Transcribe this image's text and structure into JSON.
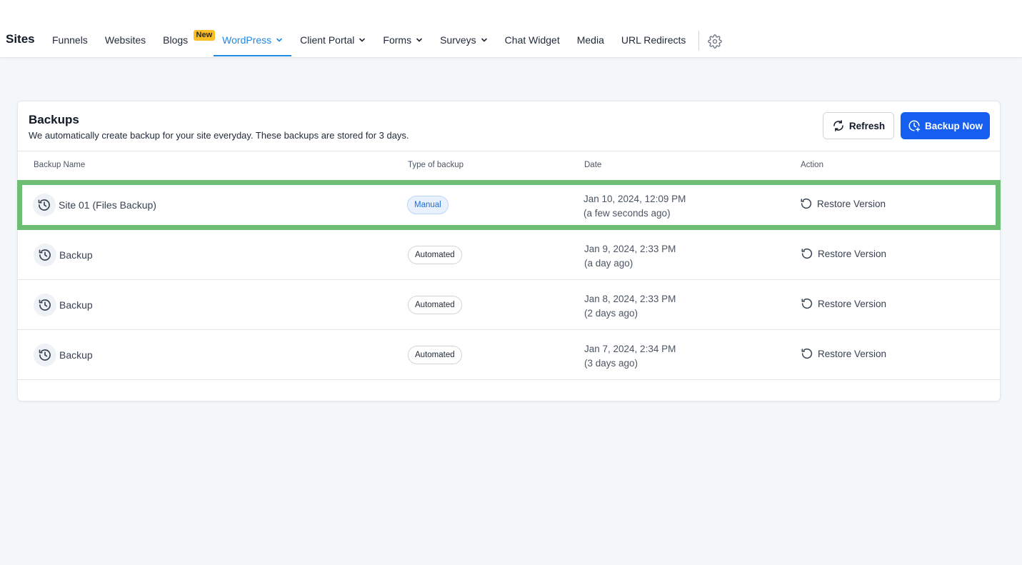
{
  "brand": "Sites",
  "nav": {
    "items": [
      {
        "label": "Funnels"
      },
      {
        "label": "Websites"
      },
      {
        "label": "Blogs",
        "badge": "New"
      },
      {
        "label": "WordPress",
        "active": true,
        "dropdown": true
      },
      {
        "label": "Client Portal",
        "dropdown": true
      },
      {
        "label": "Forms",
        "dropdown": true
      },
      {
        "label": "Surveys",
        "dropdown": true
      },
      {
        "label": "Chat Widget"
      },
      {
        "label": "Media"
      },
      {
        "label": "URL Redirects"
      }
    ],
    "settings_icon": "gear-icon"
  },
  "backups": {
    "title": "Backups",
    "subtitle": "We automatically create backup for your site everyday. These backups are stored for 3 days.",
    "refresh_label": "Refresh",
    "backup_now_label": "Backup Now",
    "columns": {
      "name": "Backup Name",
      "type": "Type of backup",
      "date": "Date",
      "action": "Action"
    },
    "rows": [
      {
        "name": "Site 01 (Files Backup)",
        "type": "Manual",
        "date": "Jan 10, 2024, 12:09 PM",
        "relative": "(a few seconds ago)",
        "action": "Restore Version"
      },
      {
        "name": "Backup",
        "type": "Automated",
        "date": "Jan 9, 2024, 2:33 PM",
        "relative": "(a day ago)",
        "action": "Restore Version"
      },
      {
        "name": "Backup",
        "type": "Automated",
        "date": "Jan 8, 2024, 2:33 PM",
        "relative": "(2 days ago)",
        "action": "Restore Version"
      },
      {
        "name": "Backup",
        "type": "Automated",
        "date": "Jan 7, 2024, 2:34 PM",
        "relative": "(3 days ago)",
        "action": "Restore Version"
      }
    ]
  },
  "colors": {
    "accent": "#1e88e5",
    "primary_button": "#155eef",
    "highlight_border": "#6dbd75",
    "new_badge": "#fbbf24"
  }
}
